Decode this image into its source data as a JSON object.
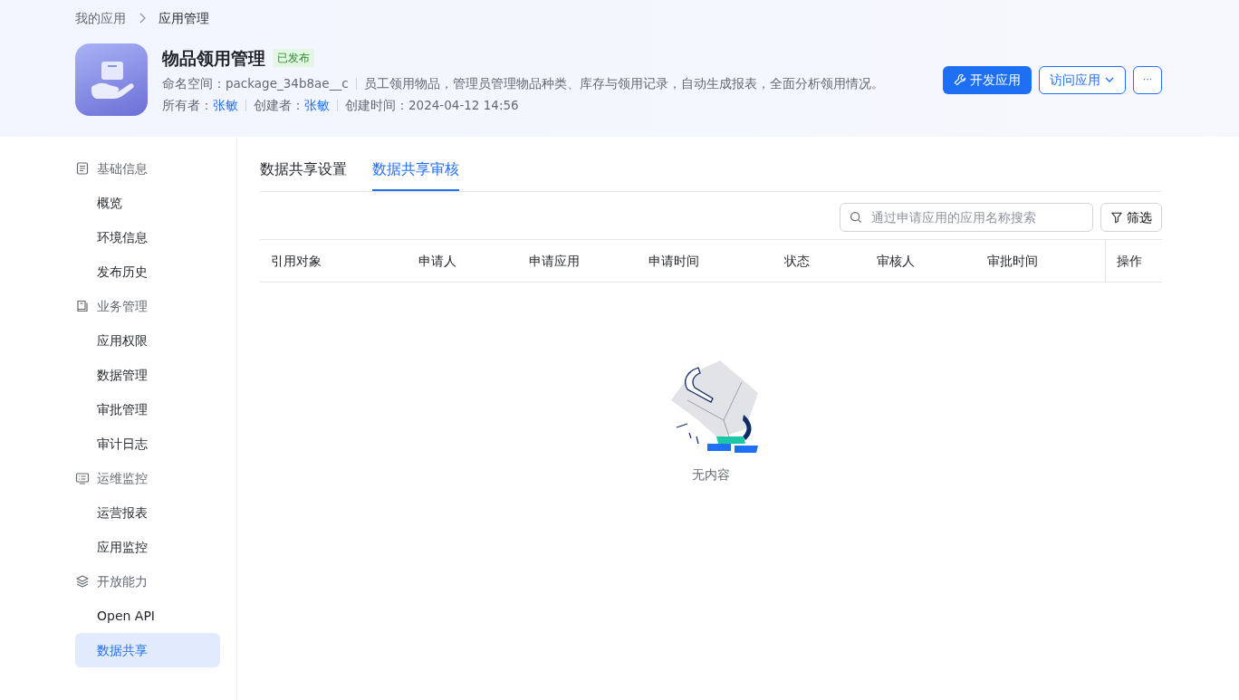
{
  "breadcrumb": [
    {
      "label": "我的应用",
      "current": false
    },
    {
      "label": "应用管理",
      "current": true
    }
  ],
  "app": {
    "name": "物品领用管理",
    "status": "已发布",
    "namespace_label": "命名空间：",
    "namespace": "package_34b8ae__c",
    "description": "员工领用物品，管理员管理物品种类、库存与领用记录，自动生成报表，全面分析领用情况。",
    "owner_label": "所有者：",
    "owner": "张敏",
    "creator_label": "创建者：",
    "creator": "张敏",
    "created_label": "创建时间：",
    "created": "2024-04-12 14:56"
  },
  "actions": [
    {
      "label": "开发应用",
      "kind": "primary"
    },
    {
      "label": "访问应用",
      "kind": "dropdown"
    },
    {
      "label": "···",
      "kind": "more"
    }
  ],
  "sidebar": {
    "groups": [
      {
        "label": "基础信息",
        "items": [
          {
            "label": "概览",
            "selected": false
          },
          {
            "label": "环境信息",
            "selected": false
          },
          {
            "label": "发布历史",
            "selected": false
          }
        ]
      },
      {
        "label": "业务管理",
        "items": [
          {
            "label": "应用权限",
            "selected": false
          },
          {
            "label": "数据管理",
            "selected": false
          },
          {
            "label": "审批管理",
            "selected": false
          },
          {
            "label": "审计日志",
            "selected": false
          }
        ]
      },
      {
        "label": "运维监控",
        "items": [
          {
            "label": "运营报表",
            "selected": false
          },
          {
            "label": "应用监控",
            "selected": false
          }
        ]
      },
      {
        "label": "开放能力",
        "items": [
          {
            "label": "Open API",
            "selected": false
          },
          {
            "label": "数据共享",
            "selected": true
          }
        ]
      }
    ]
  },
  "tabs": [
    {
      "label": "数据共享设置",
      "selected": false
    },
    {
      "label": "数据共享审核",
      "selected": true
    }
  ],
  "search": {
    "placeholder": "通过申请应用的应用名称搜索"
  },
  "filter_button": "筛选",
  "table": {
    "columns": [
      "引用对象",
      "申请人",
      "申请应用",
      "申请时间",
      "状态",
      "审核人",
      "审批时间",
      "操作"
    ]
  },
  "empty_text": "无内容"
}
